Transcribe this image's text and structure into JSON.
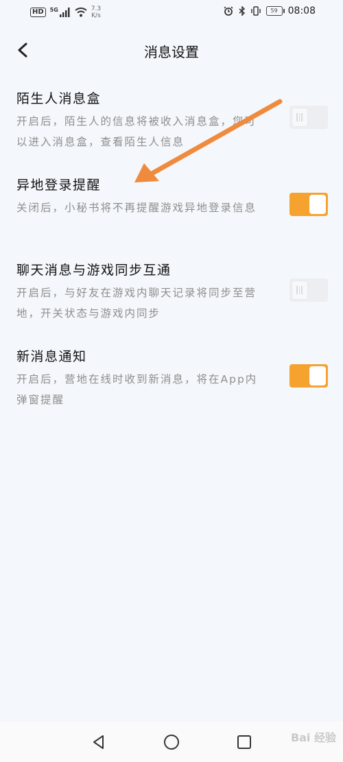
{
  "status": {
    "hd": "HD",
    "network": "5G",
    "speed_value": "7.3",
    "speed_unit": "K/s",
    "battery": "59",
    "time": "08:08"
  },
  "header": {
    "title": "消息设置"
  },
  "settings": [
    {
      "title": "陌生人消息盒",
      "desc": "开启后，陌生人的信息将被收入消息盒，您可以进入消息盒，查看陌生人信息",
      "state": "off"
    },
    {
      "title": "异地登录提醒",
      "desc": "关闭后，小秘书将不再提醒游戏异地登录信息",
      "state": "on"
    },
    {
      "title": "聊天消息与游戏同步互通",
      "desc": "开启后，与好友在游戏内聊天记录将同步至营地，开关状态与游戏内同步",
      "state": "off"
    },
    {
      "title": "新消息通知",
      "desc": "开启后，营地在线时收到新消息，将在App内弹窗提醒",
      "state": "on"
    }
  ],
  "colors": {
    "accent": "#f5a22e",
    "annotation_arrow": "#f08a3c",
    "background": "#f4f7fb"
  },
  "watermark": "Bai 经验"
}
